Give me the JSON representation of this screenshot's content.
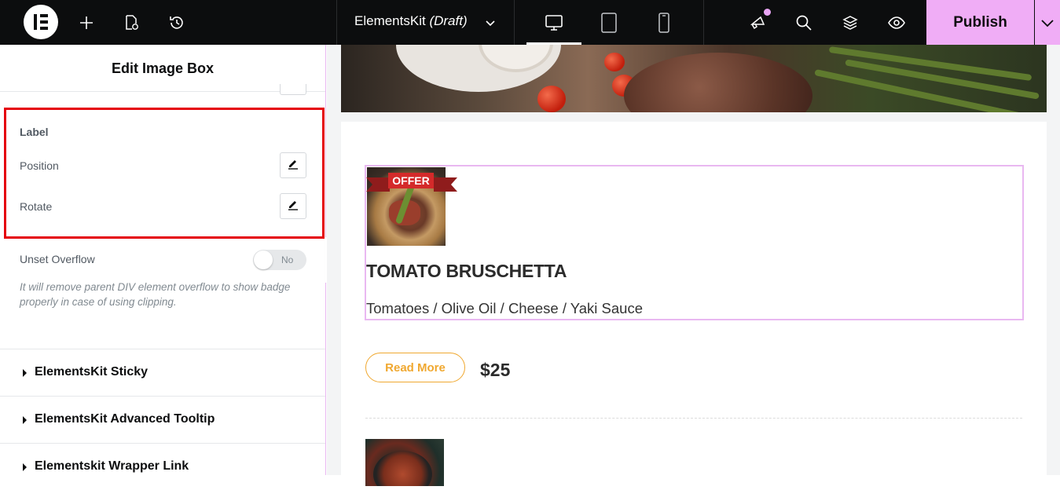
{
  "topbar": {
    "document_name": "ElementsKit",
    "document_status": "(Draft)",
    "publish_label": "Publish"
  },
  "panel": {
    "title": "Edit Image Box",
    "label_section": {
      "heading": "Label",
      "position_label": "Position",
      "rotate_label": "Rotate"
    },
    "unset_overflow": {
      "label": "Unset Overflow",
      "toggle_value": "No",
      "help_text": "It will remove parent DIV element overflow to show badge properly in case of using clipping."
    },
    "sections": [
      {
        "label": "ElementsKit Sticky"
      },
      {
        "label": "ElementsKit Advanced Tooltip"
      },
      {
        "label": "Elementskit Wrapper Link"
      }
    ]
  },
  "canvas": {
    "badge": "OFFER",
    "item_title": "TOMATO BRUSCHETTA",
    "item_description": "Tomatoes / Olive Oil / Cheese / Yaki Sauce",
    "read_more_label": "Read More",
    "price": "$25"
  },
  "colors": {
    "topbar_bg": "#0c0d0e",
    "publish_bg": "#f0adf6",
    "highlight_border": "#e5000b",
    "selection_border": "#e9b8f1",
    "accent_orange": "#f0a830",
    "badge_red": "#d42a2a"
  }
}
